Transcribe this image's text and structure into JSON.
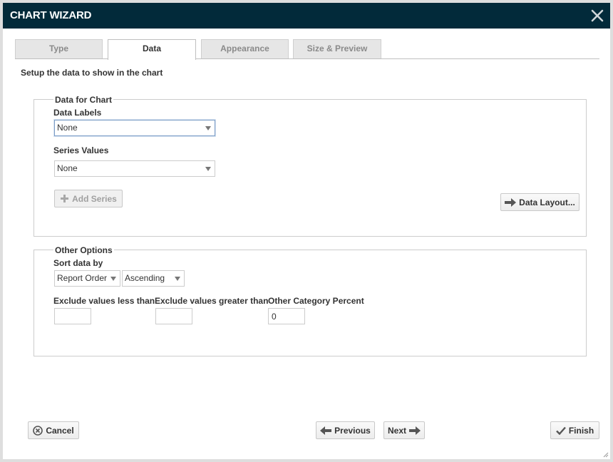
{
  "window": {
    "title": "CHART WIZARD"
  },
  "tabs": [
    {
      "label": "Type"
    },
    {
      "label": "Data"
    },
    {
      "label": "Appearance"
    },
    {
      "label": "Size & Preview"
    }
  ],
  "subtitle": "Setup the data to show in the chart",
  "data_for_chart": {
    "legend": "Data for Chart",
    "data_labels_label": "Data Labels",
    "data_labels_value": "None",
    "series_values_label": "Series Values",
    "series_values_value": "None",
    "add_series_label": "Add Series",
    "data_layout_label": "Data Layout..."
  },
  "other_options": {
    "legend": "Other Options",
    "sort_label": "Sort data by",
    "sort_field_value": "Report Order",
    "sort_order_value": "Ascending",
    "exclude_less_label": "Exclude values less than",
    "exclude_less_value": "",
    "exclude_greater_label": "Exclude values greater than",
    "exclude_greater_value": "",
    "other_percent_label": "Other Category Percent",
    "other_percent_value": "0"
  },
  "footer": {
    "cancel_label": "Cancel",
    "previous_label": "Previous",
    "next_label": "Next",
    "finish_label": "Finish"
  },
  "colors": {
    "titlebar": "#022a3a",
    "background": "#ffffff",
    "border": "#cccccc"
  }
}
